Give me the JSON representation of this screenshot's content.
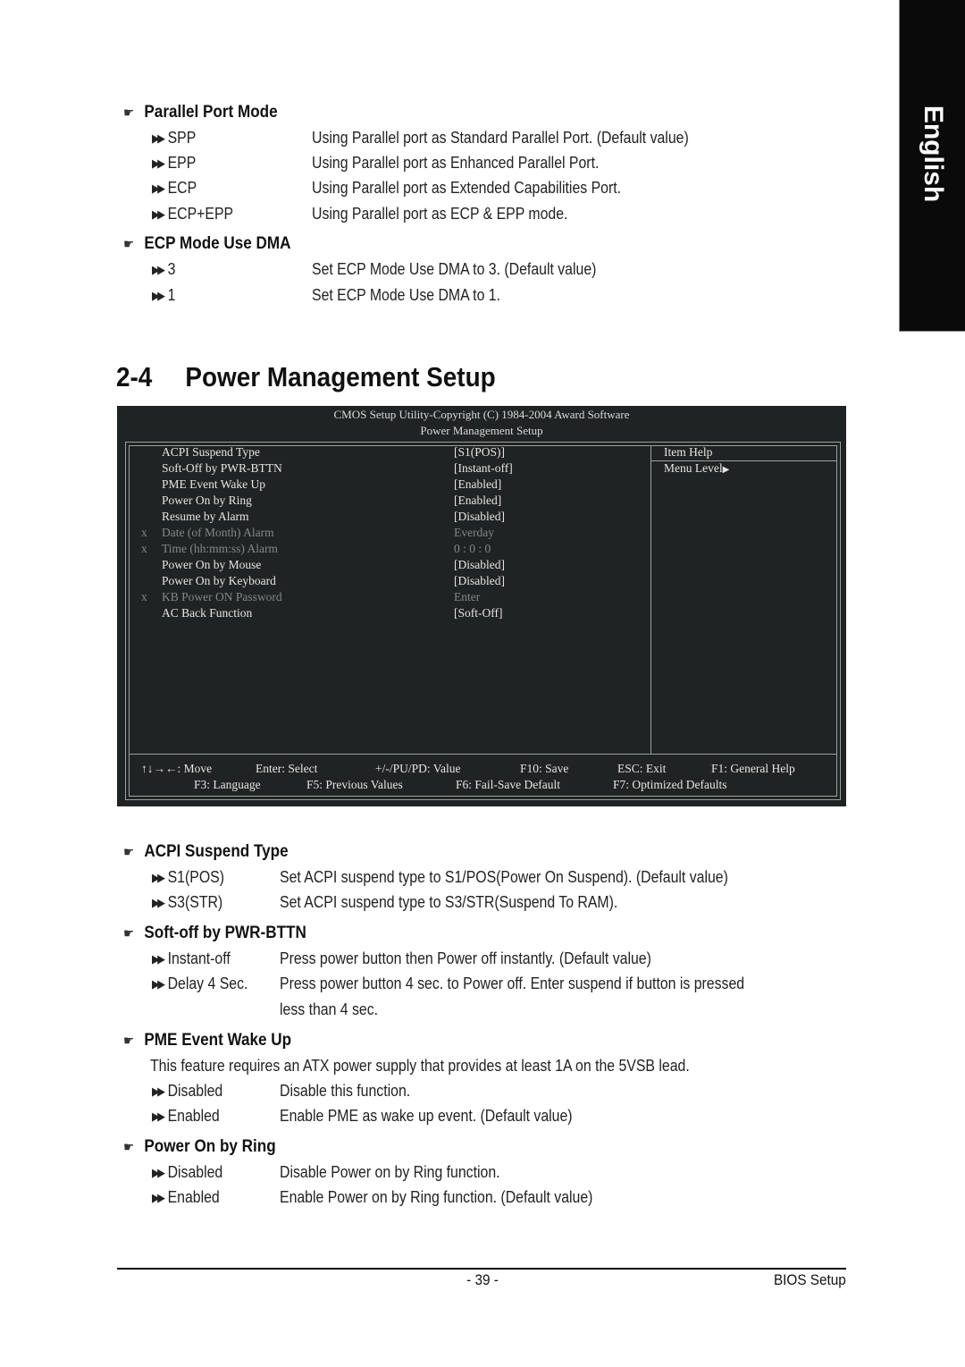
{
  "language_tab": "English",
  "sections_top": [
    {
      "title": "Parallel Port Mode",
      "options": [
        {
          "label": "SPP",
          "desc": "Using Parallel port as Standard Parallel Port. (Default value)"
        },
        {
          "label": "EPP",
          "desc": "Using Parallel port as Enhanced Parallel Port."
        },
        {
          "label": "ECP",
          "desc": "Using Parallel port as Extended Capabilities Port."
        },
        {
          "label": "ECP+EPP",
          "desc": "Using Parallel port as ECP & EPP mode."
        }
      ]
    },
    {
      "title": "ECP Mode Use DMA",
      "options": [
        {
          "label": "3",
          "desc": "Set ECP Mode Use DMA to 3. (Default value)"
        },
        {
          "label": "1",
          "desc": "Set ECP Mode Use DMA to 1."
        }
      ]
    }
  ],
  "heading": {
    "number": "2-4",
    "title": "Power Management Setup"
  },
  "bios": {
    "title_line1": "CMOS Setup Utility-Copyright (C) 1984-2004 Award Software",
    "title_line2": "Power Management Setup",
    "rows": [
      {
        "marker": "",
        "label": "ACPI Suspend Type",
        "value": "[S1(POS)]",
        "disabled": false
      },
      {
        "marker": "",
        "label": "Soft-Off by PWR-BTTN",
        "value": "[Instant-off]",
        "disabled": false
      },
      {
        "marker": "",
        "label": "PME Event Wake Up",
        "value": "[Enabled]",
        "disabled": false
      },
      {
        "marker": "",
        "label": "Power On by Ring",
        "value": "[Enabled]",
        "disabled": false
      },
      {
        "marker": "",
        "label": "Resume by Alarm",
        "value": "[Disabled]",
        "disabled": false
      },
      {
        "marker": "x",
        "label": "Date (of Month) Alarm",
        "value": "Everday",
        "disabled": true
      },
      {
        "marker": "x",
        "label": "Time (hh:mm:ss) Alarm",
        "value": "0 : 0 : 0",
        "disabled": true
      },
      {
        "marker": "",
        "label": "Power On by Mouse",
        "value": "[Disabled]",
        "disabled": false
      },
      {
        "marker": "",
        "label": "Power On by Keyboard",
        "value": "[Disabled]",
        "disabled": false
      },
      {
        "marker": "x",
        "label": "KB Power ON Password",
        "value": "Enter",
        "disabled": true
      },
      {
        "marker": "",
        "label": "AC Back Function",
        "value": "[Soft-Off]",
        "disabled": false
      }
    ],
    "item_help": "Item Help",
    "menu_level": "Menu Level",
    "footer_row1": [
      "↑↓→←: Move",
      "Enter: Select",
      "+/-/PU/PD: Value",
      "F10: Save",
      "ESC: Exit",
      "F1: General Help"
    ],
    "footer_row2": [
      "F3: Language",
      "F5: Previous Values",
      "F6: Fail-Save Default",
      "F7: Optimized Defaults"
    ]
  },
  "sections_bottom": [
    {
      "title": "ACPI Suspend Type",
      "options": [
        {
          "label": "S1(POS)",
          "desc": "Set ACPI suspend type to S1/POS(Power On Suspend). (Default value)"
        },
        {
          "label": "S3(STR)",
          "desc": "Set ACPI suspend type to S3/STR(Suspend To RAM)."
        }
      ]
    },
    {
      "title": "Soft-off by PWR-BTTN",
      "options": [
        {
          "label": "Instant-off",
          "desc": "Press power button then Power off instantly. (Default value)"
        },
        {
          "label": "Delay 4 Sec.",
          "desc": "Press power button 4 sec. to Power off. Enter suspend if button is pressed",
          "desc2": "less than 4 sec."
        }
      ]
    },
    {
      "title": "PME Event Wake Up",
      "note": "This feature requires an ATX power supply that provides at least 1A on the 5VSB lead.",
      "options": [
        {
          "label": "Disabled",
          "desc": "Disable this function."
        },
        {
          "label": "Enabled",
          "desc": "Enable PME as wake up event. (Default value)"
        }
      ]
    },
    {
      "title": "Power On by Ring",
      "options": [
        {
          "label": "Disabled",
          "desc": "Disable Power on by Ring function."
        },
        {
          "label": "Enabled",
          "desc": "Enable Power on by Ring function. (Default value)"
        }
      ]
    }
  ],
  "footer": {
    "page_number": "- 39 -",
    "section_name": "BIOS Setup"
  }
}
